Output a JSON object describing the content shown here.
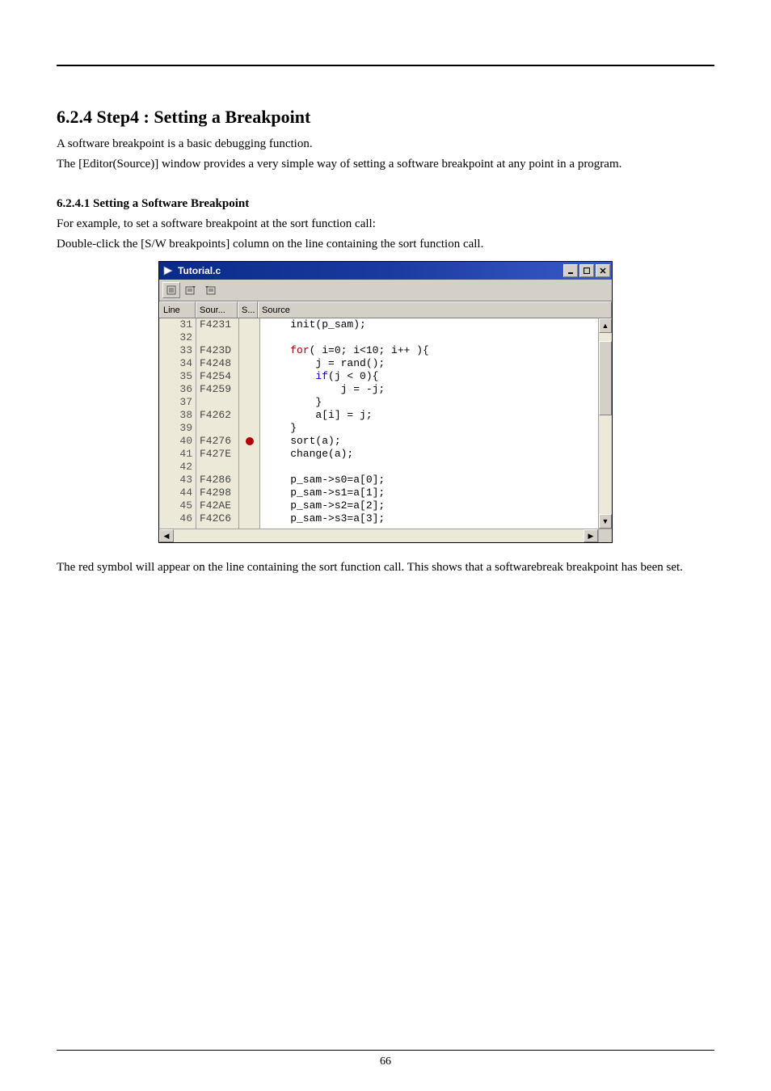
{
  "heading": "6.2.4 Step4 : Setting a Breakpoint",
  "intro_p1": "A software breakpoint is a basic debugging function.",
  "intro_p2": "The [Editor(Source)] window provides a very simple way of setting a software breakpoint at any point in a program.",
  "sub_heading": "6.2.4.1 Setting a Software Breakpoint",
  "sub_p1": "For example, to set a software breakpoint at the sort function call:",
  "sub_p2": "Double-click the [S/W breakpoints] column on the line containing the sort function call.",
  "window": {
    "title": "Tutorial.c",
    "columns": {
      "line": "Line",
      "sour": "Sour...",
      "s": "S...",
      "source": "Source"
    },
    "rows": [
      {
        "line": "31",
        "addr": "F4231",
        "bp": false,
        "src": "    init(p_sam);",
        "style": "plain"
      },
      {
        "line": "32",
        "addr": "",
        "bp": false,
        "src": "",
        "style": "plain"
      },
      {
        "line": "33",
        "addr": "F423D",
        "bp": false,
        "src": "    for( i=0; i<10; i++ ){",
        "style": "for"
      },
      {
        "line": "34",
        "addr": "F4248",
        "bp": false,
        "src": "        j = rand();",
        "style": "plain"
      },
      {
        "line": "35",
        "addr": "F4254",
        "bp": false,
        "src": "        if(j < 0){",
        "style": "if"
      },
      {
        "line": "36",
        "addr": "F4259",
        "bp": false,
        "src": "            j = -j;",
        "style": "plain"
      },
      {
        "line": "37",
        "addr": "",
        "bp": false,
        "src": "        }",
        "style": "plain"
      },
      {
        "line": "38",
        "addr": "F4262",
        "bp": false,
        "src": "        a[i] = j;",
        "style": "plain"
      },
      {
        "line": "39",
        "addr": "",
        "bp": false,
        "src": "    }",
        "style": "plain"
      },
      {
        "line": "40",
        "addr": "F4276",
        "bp": true,
        "src": "    sort(a);",
        "style": "plain"
      },
      {
        "line": "41",
        "addr": "F427E",
        "bp": false,
        "src": "    change(a);",
        "style": "plain"
      },
      {
        "line": "42",
        "addr": "",
        "bp": false,
        "src": "",
        "style": "plain"
      },
      {
        "line": "43",
        "addr": "F4286",
        "bp": false,
        "src": "    p_sam->s0=a[0];",
        "style": "plain"
      },
      {
        "line": "44",
        "addr": "F4298",
        "bp": false,
        "src": "    p_sam->s1=a[1];",
        "style": "plain"
      },
      {
        "line": "45",
        "addr": "F42AE",
        "bp": false,
        "src": "    p_sam->s2=a[2];",
        "style": "plain"
      },
      {
        "line": "46",
        "addr": "F42C6",
        "bp": false,
        "src": "    p_sam->s3=a[3];",
        "style": "plain"
      }
    ]
  },
  "closing": "The red symbol will appear on the line containing the sort function call. This shows that a softwarebreak breakpoint has been set.",
  "page_number": "66"
}
